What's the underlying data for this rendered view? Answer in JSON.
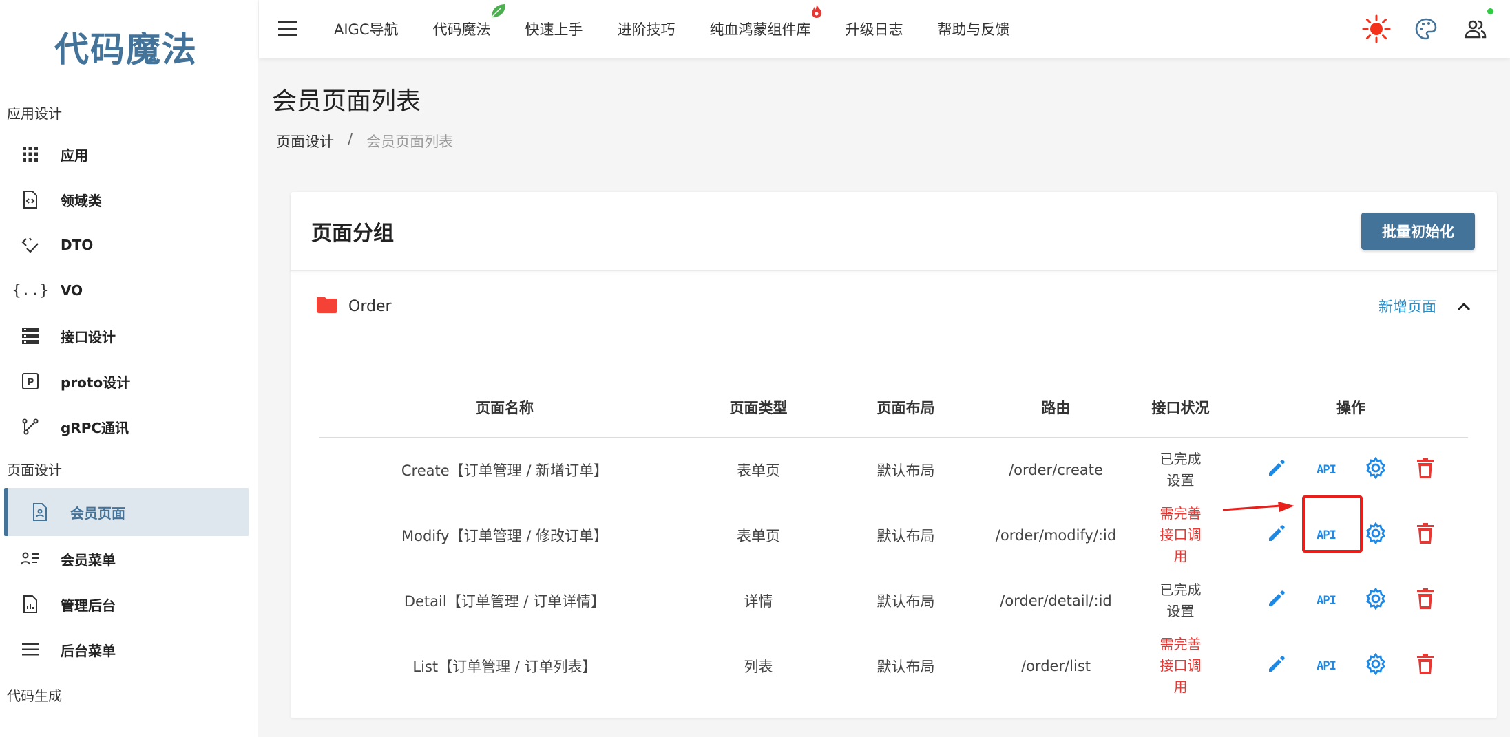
{
  "brand": {
    "title": "代码魔法"
  },
  "sidebar": {
    "sections": [
      {
        "title": "应用设计",
        "items": [
          {
            "label": "应用",
            "icon": "grid-icon"
          },
          {
            "label": "领域类",
            "icon": "code-file-icon"
          },
          {
            "label": "DTO",
            "icon": "code-check-icon"
          },
          {
            "label": "VO",
            "icon": "braces-icon"
          },
          {
            "label": "接口设计",
            "icon": "server-icon"
          },
          {
            "label": "proto设计",
            "icon": "proto-box-icon"
          },
          {
            "label": "gRPC通讯",
            "icon": "graph-icon"
          }
        ]
      },
      {
        "title": "页面设计",
        "items": [
          {
            "label": "会员页面",
            "icon": "user-file-icon",
            "active": true
          },
          {
            "label": "会员菜单",
            "icon": "user-list-icon"
          },
          {
            "label": "管理后台",
            "icon": "chart-file-icon"
          },
          {
            "label": "后台菜单",
            "icon": "menu-icon"
          }
        ]
      },
      {
        "title": "代码生成"
      }
    ]
  },
  "topbar": {
    "nav": [
      "AIGC导航",
      "代码魔法",
      "快速上手",
      "进阶技巧",
      "纯血鸿蒙组件库",
      "升级日志",
      "帮助与反馈"
    ],
    "right_icons": [
      "sun-icon",
      "palette-icon",
      "users-icon"
    ]
  },
  "page": {
    "title": "会员页面列表",
    "breadcrumb": {
      "parent": "页面设计",
      "separator": "/",
      "current": "会员页面列表"
    }
  },
  "card": {
    "title": "页面分组",
    "batch_button": "批量初始化",
    "group": {
      "name": "Order",
      "add_link": "新增页面"
    },
    "columns": [
      "页面名称",
      "页面类型",
      "页面布局",
      "路由",
      "接口状况",
      "操作"
    ],
    "rows": [
      {
        "name": "Create【订单管理 / 新增订单】",
        "type": "表单页",
        "layout": "默认布局",
        "route": "/order/create",
        "status": [
          "已完成",
          "设置"
        ],
        "status_kind": "ok"
      },
      {
        "name": "Modify【订单管理 / 修改订单】",
        "type": "表单页",
        "layout": "默认布局",
        "route": "/order/modify/:id",
        "status": [
          "需完善",
          "接口调",
          "用"
        ],
        "status_kind": "warn"
      },
      {
        "name": "Detail【订单管理 / 订单详情】",
        "type": "详情",
        "layout": "默认布局",
        "route": "/order/detail/:id",
        "status": [
          "已完成",
          "设置"
        ],
        "status_kind": "ok"
      },
      {
        "name": "List【订单管理 / 订单列表】",
        "type": "列表",
        "layout": "默认布局",
        "route": "/order/list",
        "status": [
          "需完善",
          "接口调",
          "用"
        ],
        "status_kind": "warn"
      }
    ],
    "api_label": "API"
  },
  "colors": {
    "brand": "#44739a",
    "link": "#2a8fc7",
    "warn": "#e53935",
    "icon_blue": "#1e88e5",
    "delete_red": "#e53935"
  }
}
